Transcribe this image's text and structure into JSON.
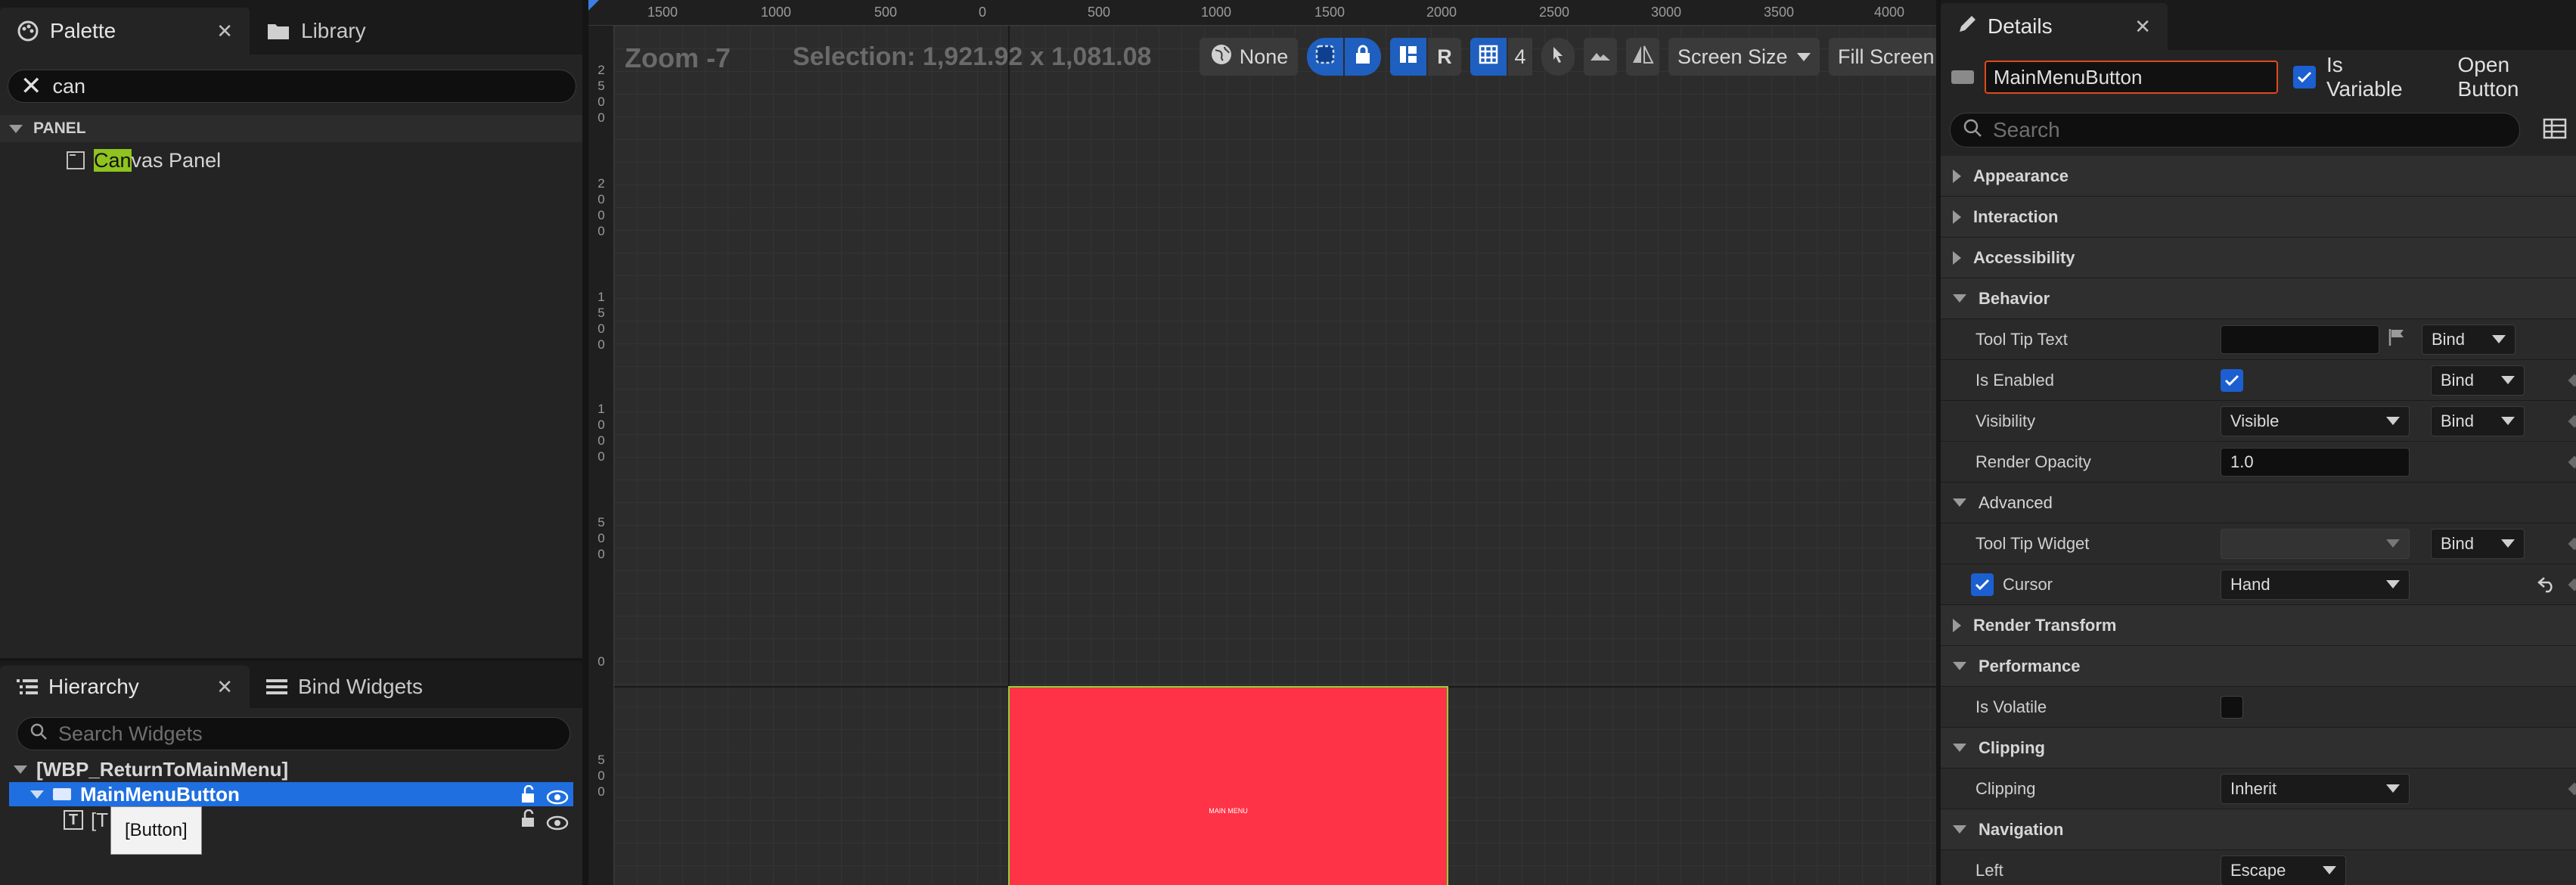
{
  "palette": {
    "tab_palette": "Palette",
    "tab_library": "Library",
    "search_value": "can",
    "category": "PANEL",
    "item_highlight": "Can",
    "item_rest": "vas Panel"
  },
  "hierarchy": {
    "tab_hierarchy": "Hierarchy",
    "tab_bind": "Bind Widgets",
    "search_placeholder": "Search Widgets",
    "root": "[WBP_ReturnToMainMenu]",
    "selected": "MainMenuButton",
    "child": "[T      MENU\"",
    "tooltip": "[Button]"
  },
  "viewport": {
    "zoom": "Zoom -7",
    "selection": "Selection: 1,921.92 x 1,081.08",
    "none_label": "None",
    "r_label": "R",
    "grid_num": "4",
    "screen_size": "Screen Size",
    "fill_screen": "Fill Screen",
    "ruler_top": [
      "1500",
      "1000",
      "500",
      "0",
      "500",
      "1000",
      "1500",
      "2000",
      "2500",
      "3000",
      "3500",
      "4000"
    ],
    "ruler_left": [
      "2500",
      "2000",
      "1500",
      "1000",
      "500",
      "0",
      "500"
    ],
    "button_text": "MAIN MENU",
    "button_color": "#ff3347"
  },
  "details": {
    "tab": "Details",
    "name_value": "MainMenuButton",
    "is_variable": "Is Variable",
    "open_button": "Open Button",
    "search_placeholder": "Search",
    "groups": {
      "appearance": "Appearance",
      "interaction": "Interaction",
      "accessibility": "Accessibility",
      "behavior": "Behavior",
      "advanced": "Advanced",
      "render_transform": "Render Transform",
      "performance": "Performance",
      "clipping": "Clipping",
      "navigation": "Navigation"
    },
    "props": {
      "tool_tip_text": "Tool Tip Text",
      "is_enabled": "Is Enabled",
      "visibility": "Visibility",
      "visibility_value": "Visible",
      "render_opacity": "Render Opacity",
      "render_opacity_value": "1.0",
      "tool_tip_widget": "Tool Tip Widget",
      "cursor": "Cursor",
      "cursor_value": "Hand",
      "is_volatile": "Is Volatile",
      "clipping": "Clipping",
      "clipping_value": "Inherit",
      "left": "Left",
      "left_value": "Escape"
    },
    "bind_label": "Bind"
  }
}
